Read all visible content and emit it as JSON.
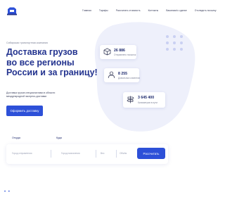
{
  "header": {
    "nav": [
      "Главная",
      "Тарифы",
      "Рассчитать стоимость",
      "Контакты",
      "Вакансии/о сделке",
      "Отследить посылку"
    ]
  },
  "hero": {
    "tagline": "Сибирская транспортная компания",
    "title_lines": [
      "Доставка грузов",
      "во все регионы",
      "России и за границу!"
    ],
    "description": "Доставка грузов специалистами в области международной экспресс-доставки",
    "cta_label": "Оформить доставку"
  },
  "stats": [
    {
      "value": "26 886",
      "label": "Отправлено посылок",
      "icon": "box-icon"
    },
    {
      "value": "8 255",
      "label": "Довольных клиентов",
      "icon": "person-icon"
    },
    {
      "value": "3 645 400",
      "label": "Километров в пути",
      "icon": "signpost-icon"
    }
  ],
  "form": {
    "from_label": "Откуда",
    "to_label": "Куда",
    "from_placeholder": "Город отправления",
    "to_placeholder": "Город назначения",
    "weight_placeholder": "Вес",
    "volume_placeholder": "Объём",
    "submit_label": "Рассчитать"
  },
  "colors": {
    "accent": "#2d50d8",
    "title": "#23338f",
    "blob": "#eef0fb"
  }
}
